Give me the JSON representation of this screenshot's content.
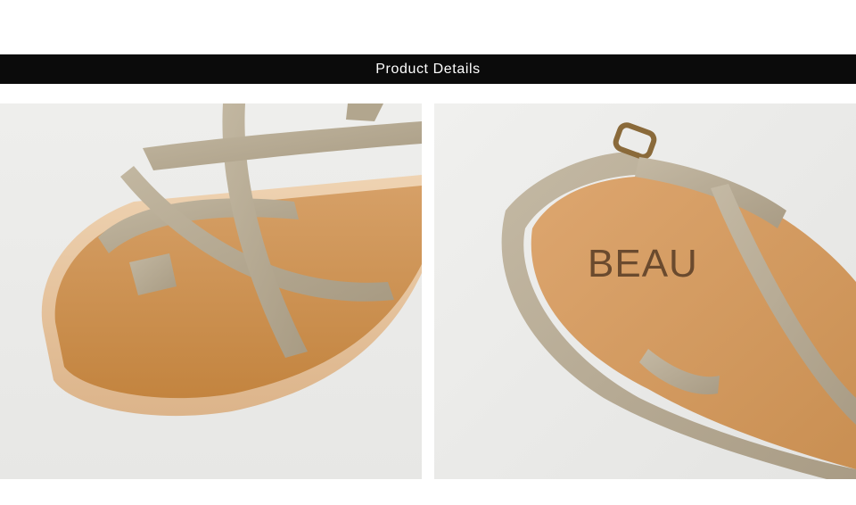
{
  "header": {
    "title": "Product Details"
  },
  "photos": [
    {
      "name": "sandal-toe-closeup",
      "colors": {
        "strap": "#b7aa93",
        "footbed": "#c98f52",
        "sole": "#e9c9a6",
        "background": "#ececea"
      }
    },
    {
      "name": "sandal-heel-closeup",
      "brand_mark": "BEAU",
      "colors": {
        "strap": "#b5a993",
        "footbed": "#d39a63",
        "buckle": "#8a6a3a",
        "background": "#ececea"
      }
    }
  ]
}
